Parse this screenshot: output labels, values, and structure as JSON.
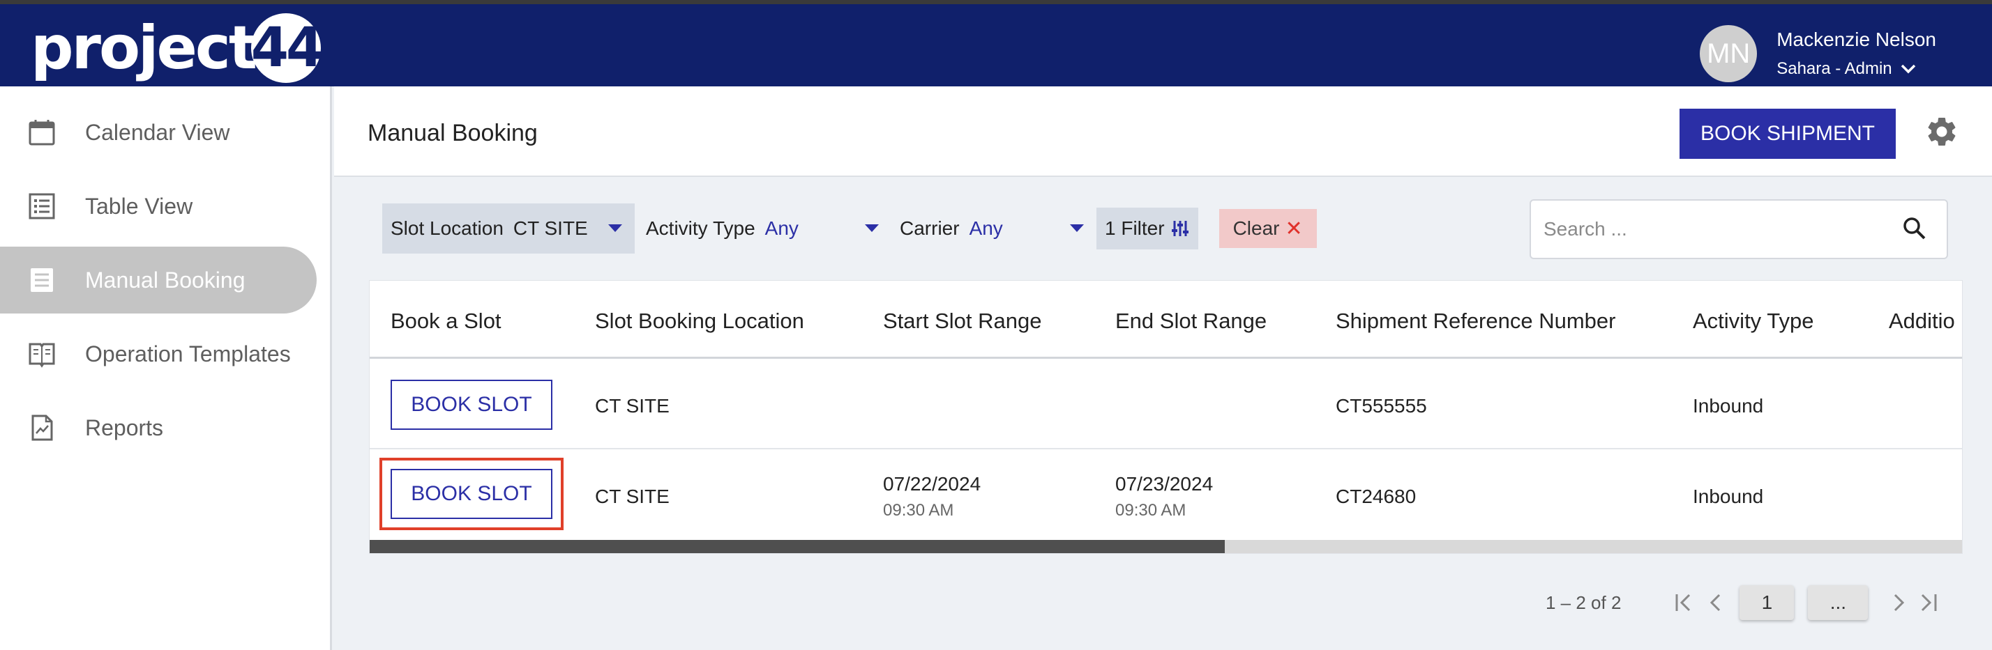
{
  "app": {
    "logo_text": "project",
    "logo_number": "44"
  },
  "user": {
    "initials": "MN",
    "name": "Mackenzie Nelson",
    "role": "Sahara - Admin"
  },
  "sidebar": {
    "items": [
      {
        "label": "Calendar View",
        "icon": "calendar-icon"
      },
      {
        "label": "Table View",
        "icon": "list-icon"
      },
      {
        "label": "Manual Booking",
        "icon": "document-list-icon",
        "active": true
      },
      {
        "label": "Operation Templates",
        "icon": "book-icon"
      },
      {
        "label": "Reports",
        "icon": "report-icon"
      }
    ]
  },
  "header": {
    "title": "Manual Booking",
    "book_shipment_label": "BOOK SHIPMENT"
  },
  "filters": {
    "slot_location_label": "Slot Location",
    "slot_location_value": "CT SITE",
    "activity_type_label": "Activity Type",
    "activity_type_value": "Any",
    "carrier_label": "Carrier",
    "carrier_value": "Any",
    "filter_count_label": "1 Filter",
    "clear_label": "Clear"
  },
  "search": {
    "placeholder": "Search ..."
  },
  "table": {
    "columns": [
      "Book a Slot",
      "Slot Booking Location",
      "Start Slot Range",
      "End Slot Range",
      "Shipment Reference Number",
      "Activity Type",
      "Additio"
    ],
    "rows": [
      {
        "action": "BOOK SLOT",
        "location": "CT SITE",
        "start_date": "",
        "start_time": "",
        "end_date": "",
        "end_time": "",
        "reference": "CT555555",
        "activity": "Inbound"
      },
      {
        "action": "BOOK SLOT",
        "location": "CT SITE",
        "start_date": "07/22/2024",
        "start_time": "09:30 AM",
        "end_date": "07/23/2024",
        "end_time": "09:30 AM",
        "reference": "CT24680",
        "activity": "Inbound"
      }
    ]
  },
  "pagination": {
    "range_text": "1 – 2 of 2",
    "current_page": "1",
    "more_label": "..."
  },
  "colors": {
    "topbar": "#10206b",
    "accent": "#2b2fa6",
    "highlight": "#e0402a"
  }
}
